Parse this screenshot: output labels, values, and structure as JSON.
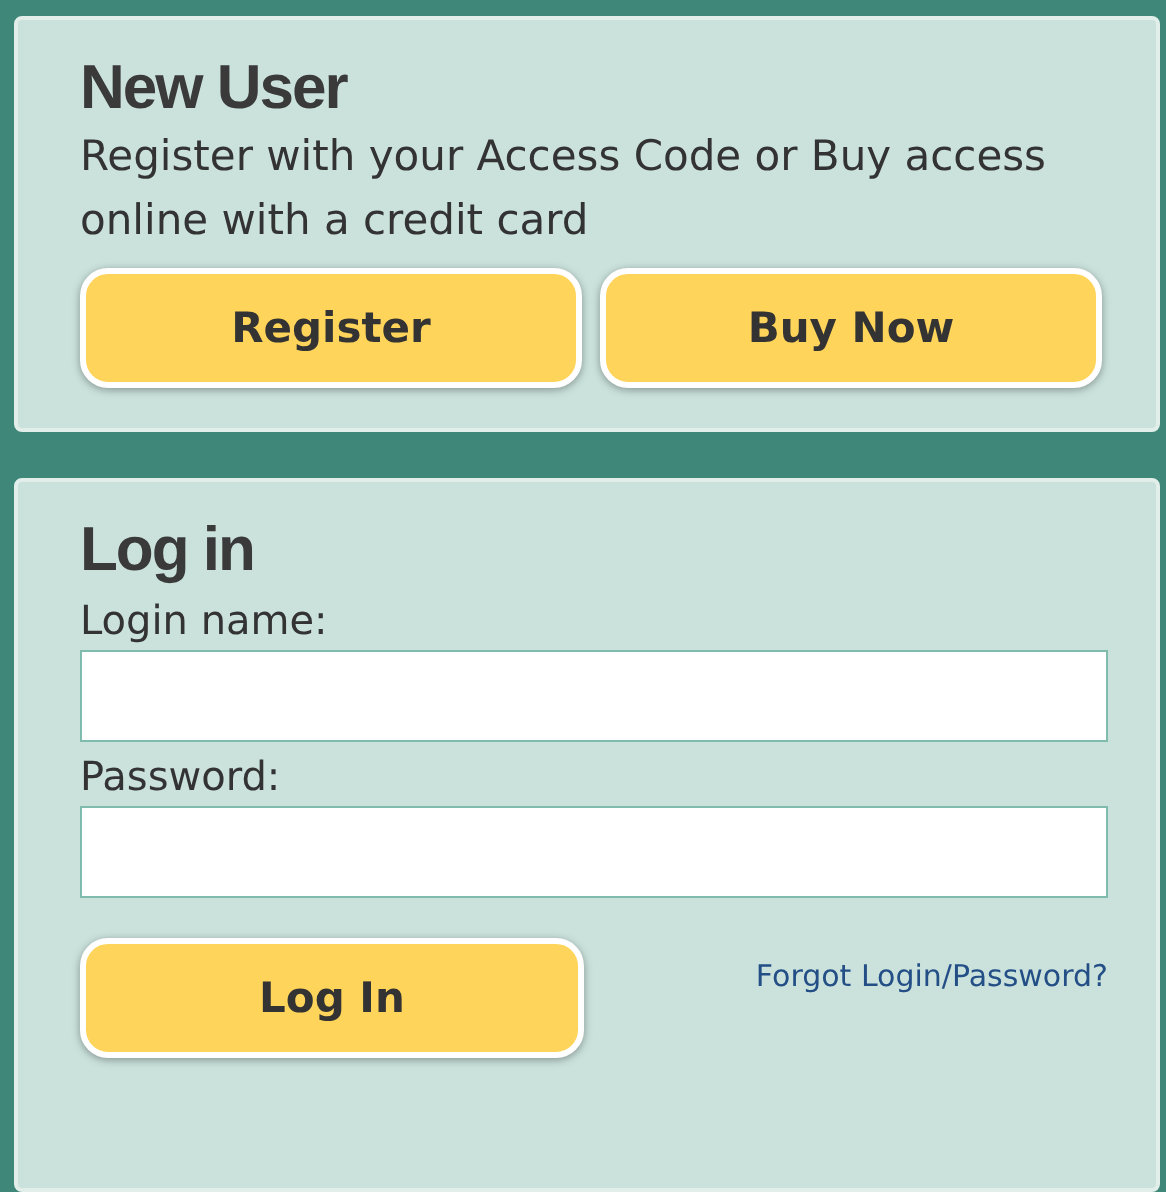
{
  "new_user": {
    "title": "New User",
    "description": "Register with your Access Code or Buy access online with a credit card",
    "buttons": [
      "Register",
      "Buy Now"
    ]
  },
  "login": {
    "title": "Log in",
    "fields": [
      {
        "label": "Login name:"
      },
      {
        "label": "Password:"
      }
    ],
    "button": "Log In",
    "forgot_link": "Forgot Login/Password?"
  }
}
